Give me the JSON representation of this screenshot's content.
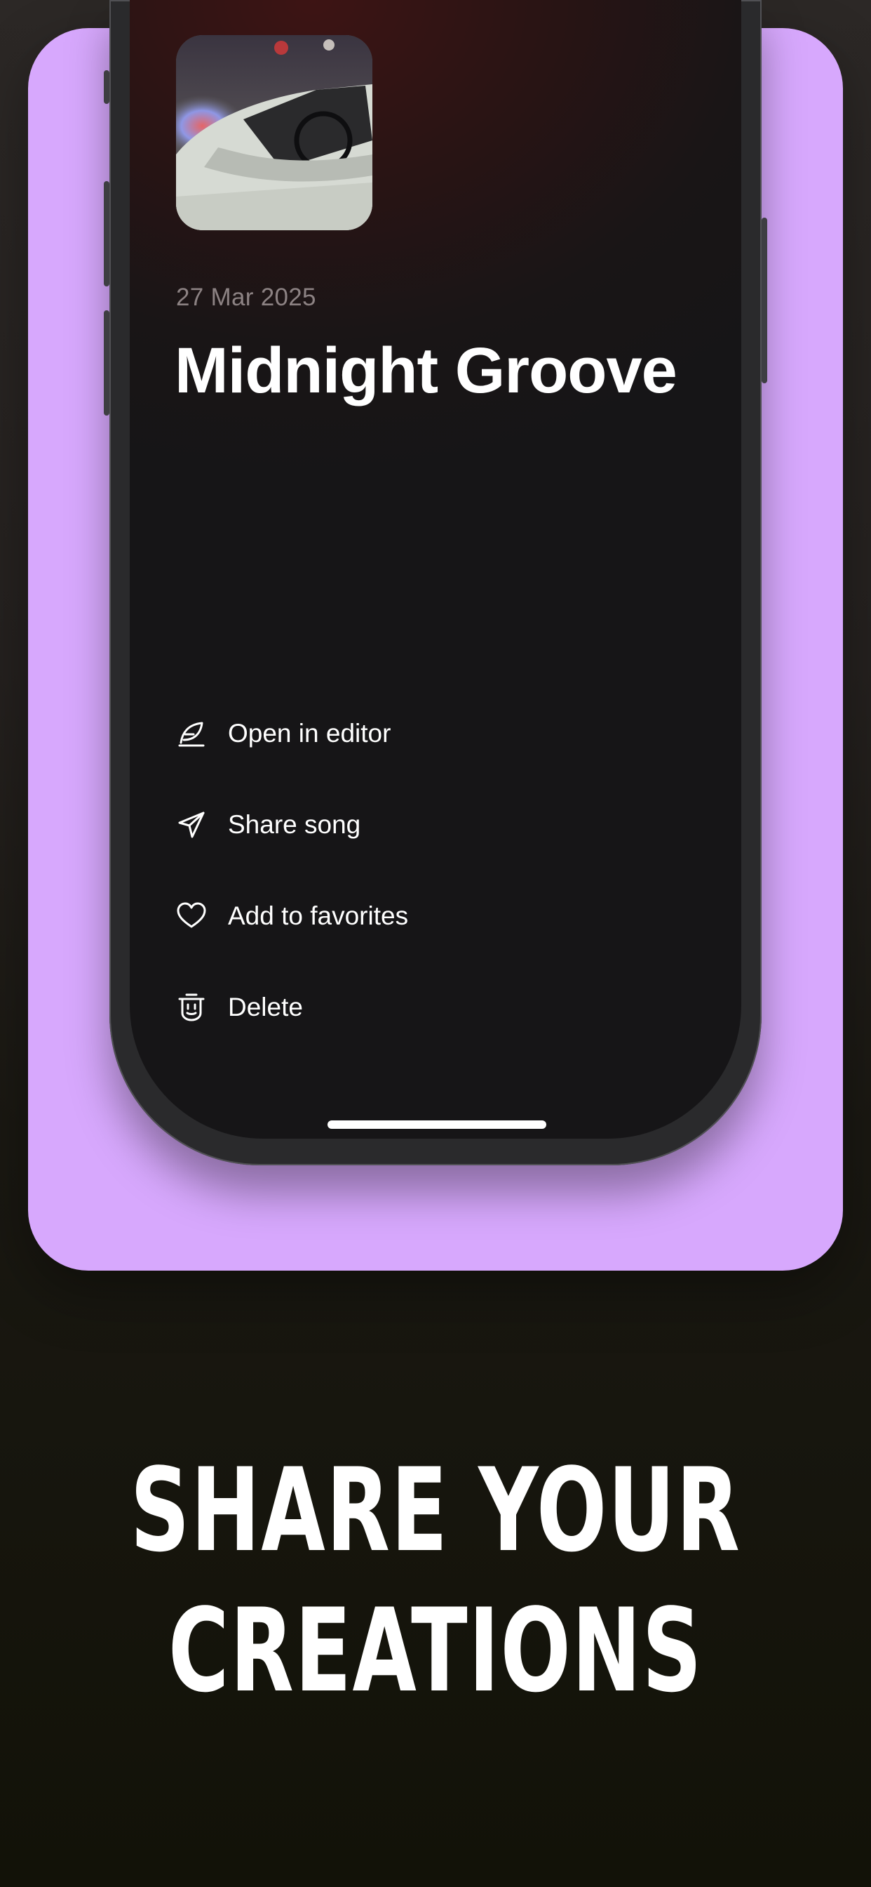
{
  "song": {
    "date": "27 Mar 2025",
    "title": "Midnight Groove"
  },
  "menu": {
    "items": [
      {
        "label": "Open in editor",
        "icon": "feather-pen-icon"
      },
      {
        "label": "Share song",
        "icon": "paper-plane-icon"
      },
      {
        "label": "Add to favorites",
        "icon": "heart-icon"
      },
      {
        "label": "Delete",
        "icon": "trash-icon"
      }
    ]
  },
  "headline": {
    "line1": "SHARE YOUR",
    "line2": "CREATIONS"
  },
  "colors": {
    "card": "#d7a8fd",
    "background": "#1a1812",
    "screen": "#161517",
    "text": "#ffffff",
    "muted_text": "#8c8283"
  }
}
